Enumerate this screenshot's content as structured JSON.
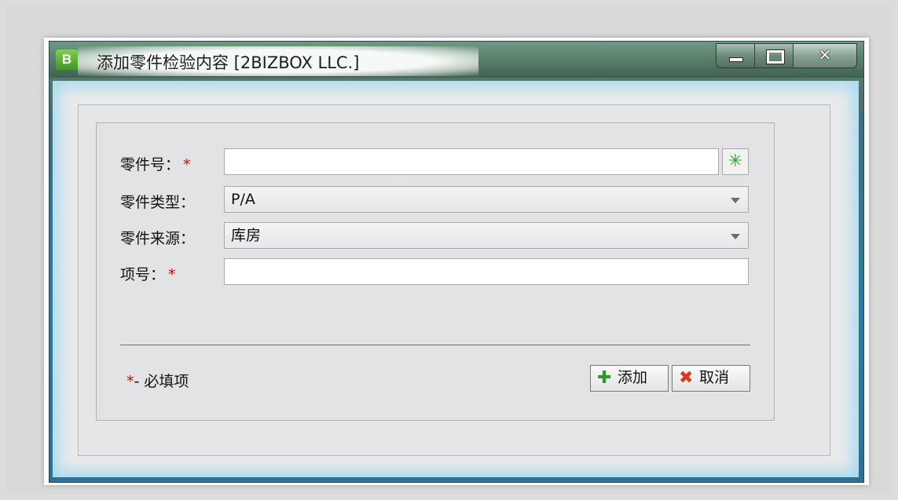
{
  "window": {
    "app_icon": "B",
    "title": "添加零件检验内容 [2BIZBOX LLC.]",
    "close_glyph": "✕"
  },
  "form": {
    "part_no": {
      "label": "零件号：",
      "required_mark": "*",
      "value": ""
    },
    "part_type": {
      "label": "零件类型：",
      "value": "P/A"
    },
    "part_source": {
      "label": "零件来源：",
      "value": "库房"
    },
    "item_no": {
      "label": "项号：",
      "required_mark": "*",
      "value": ""
    },
    "picker_icon": "✳"
  },
  "footer": {
    "legend_star": "*",
    "legend_text": "- 必填项",
    "add_icon": "✚",
    "add_label": "添加",
    "cancel_icon": "✖",
    "cancel_label": "取消"
  },
  "colors": {
    "required": "#e00000",
    "add_icon": "#2e9a2e",
    "cancel_icon": "#d83a1a",
    "frame_blue": "#2b7aa0"
  }
}
